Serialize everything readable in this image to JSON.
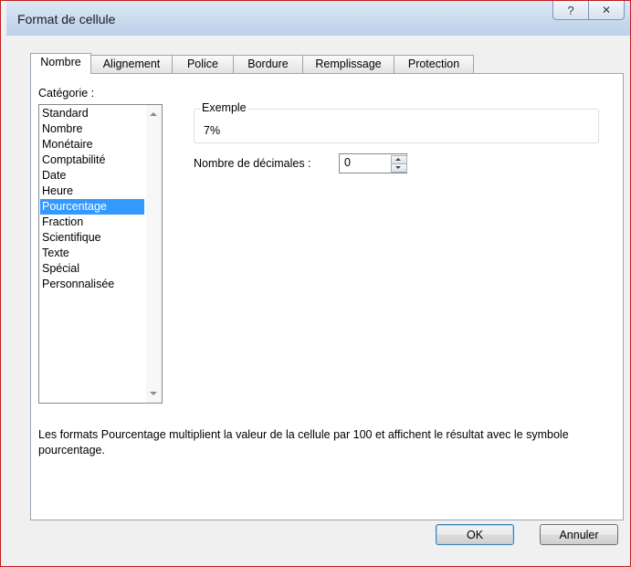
{
  "window": {
    "title": "Format de cellule",
    "help_glyph": "?",
    "close_glyph": "✕"
  },
  "tabs": [
    {
      "label": "Nombre",
      "active": true
    },
    {
      "label": "Alignement",
      "active": false
    },
    {
      "label": "Police",
      "active": false
    },
    {
      "label": "Bordure",
      "active": false
    },
    {
      "label": "Remplissage",
      "active": false
    },
    {
      "label": "Protection",
      "active": false
    }
  ],
  "category": {
    "label": "Catégorie :",
    "items": [
      "Standard",
      "Nombre",
      "Monétaire",
      "Comptabilité",
      "Date",
      "Heure",
      "Pourcentage",
      "Fraction",
      "Scientifique",
      "Texte",
      "Spécial",
      "Personnalisée"
    ],
    "selected": "Pourcentage"
  },
  "example": {
    "legend": "Exemple",
    "value": "7%"
  },
  "decimals": {
    "label": "Nombre de décimales :",
    "value": "0"
  },
  "description": "Les formats Pourcentage multiplient la valeur de la cellule par 100 et affichent le résultat avec le symbole pourcentage.",
  "buttons": {
    "ok": "OK",
    "cancel": "Annuler"
  },
  "colors": {
    "selection": "#3399ff",
    "frame_accent": "#c40f0f"
  }
}
